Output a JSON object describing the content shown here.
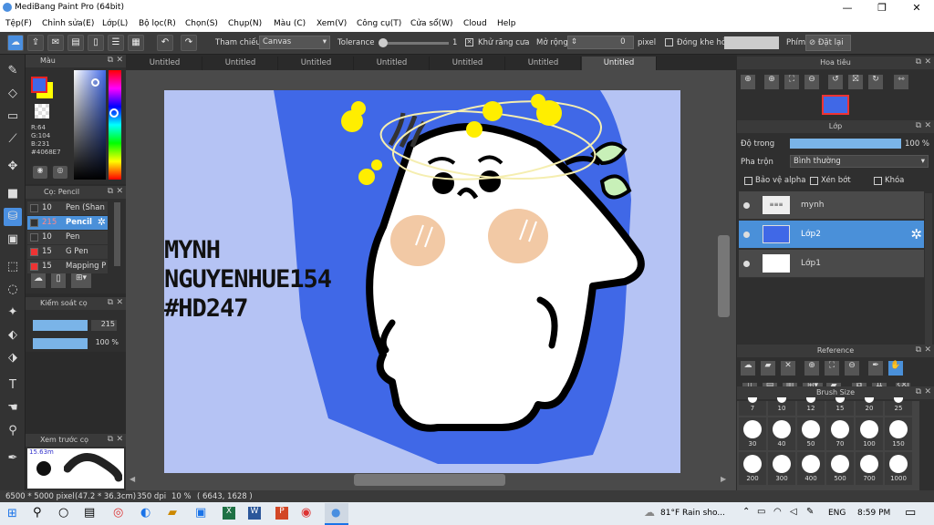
{
  "window": {
    "title": "MediBang Paint Pro (64bit)",
    "min": "—",
    "max": "❐",
    "close": "✕"
  },
  "menu": [
    "Tệp(F)",
    "Chỉnh sửa(E)",
    "Lớp(L)",
    "Bộ lọc(R)",
    "Chọn(S)",
    "Chụp(N)",
    "Màu (C)",
    "Xem(V)",
    "Công cụ(T)",
    "Cửa sổ(W)",
    "Cloud",
    "Help"
  ],
  "toolbar": {
    "ref_label": "Tham chiếu",
    "ref_value": "Canvas",
    "tolerance_label": "Tolerance",
    "tolerance_value": "1",
    "antialias_label": "Khử răng cưa",
    "expand_label": "Mở rộng",
    "expand_value": "0",
    "expand_unit": "pixel",
    "gap_label": "Đóng khe hở",
    "key_label": "Phím",
    "reset_label": "Đặt lại"
  },
  "tabs": [
    "Untitled",
    "Untitled",
    "Untitled",
    "Untitled",
    "Untitled",
    "Untitled",
    "Untitled"
  ],
  "color_panel": {
    "title": "Màu",
    "r": "R:64",
    "g": "G:104",
    "b": "B:231",
    "hex": "#4068E7",
    "fg": "#4068E7",
    "bg": "#ffff00"
  },
  "brush_panel": {
    "title": "Cọ: Pencil",
    "items": [
      {
        "size": "10",
        "name": "Pen (Shan",
        "color": "#333"
      },
      {
        "size": "215",
        "name": "Pencil",
        "color": "#333"
      },
      {
        "size": "10",
        "name": "Pen",
        "color": "#333"
      },
      {
        "size": "15",
        "name": "G Pen",
        "color": "#e33"
      },
      {
        "size": "15",
        "name": "Mapping P",
        "color": "#e33"
      }
    ]
  },
  "brush_control": {
    "title": "Kiểm soát cọ",
    "size": "215",
    "opacity": "100 %",
    "size_level": 1.0,
    "opacity_level": 1.0
  },
  "preview": {
    "title": "Xem trước cọ",
    "size": "15.63m"
  },
  "canvas_text": {
    "line1": "MYNH",
    "line2": "NGUYENHUE154",
    "line3": "#HD247"
  },
  "navigator": {
    "title": "Hoa tiêu"
  },
  "layers_panel": {
    "title": "Lớp",
    "opacity_label": "Độ trong",
    "opacity_value": "100 %",
    "opacity_level": 1.0,
    "blend_label": "Pha trộn",
    "blend_value": "Bình thường",
    "protect_alpha": "Bảo vệ alpha",
    "clipping": "Xén bớt",
    "lock": "Khóa",
    "layers": [
      {
        "name": "mynh",
        "selected": false
      },
      {
        "name": "Lớp2",
        "selected": true
      },
      {
        "name": "Lớp1",
        "selected": false
      }
    ]
  },
  "reference_panel": {
    "title": "Reference"
  },
  "brush_size_panel": {
    "title": "Brush Size",
    "row1": [
      "7",
      "10",
      "12",
      "15",
      "20",
      "25"
    ],
    "row2": [
      "30",
      "40",
      "50",
      "70",
      "100",
      "150"
    ],
    "row3": [
      "200",
      "300",
      "400",
      "500",
      "700",
      "1000"
    ]
  },
  "status": {
    "dims": "6500 * 5000 pixel",
    "cm": "(47.2 * 36.3cm)",
    "dpi": "350 dpi",
    "zoom": "10 %",
    "coords": "( 6643, 1628 )"
  },
  "taskbar": {
    "weather": "81°F  Rain sho...",
    "lang": "ENG",
    "time": "8:59 PM"
  }
}
